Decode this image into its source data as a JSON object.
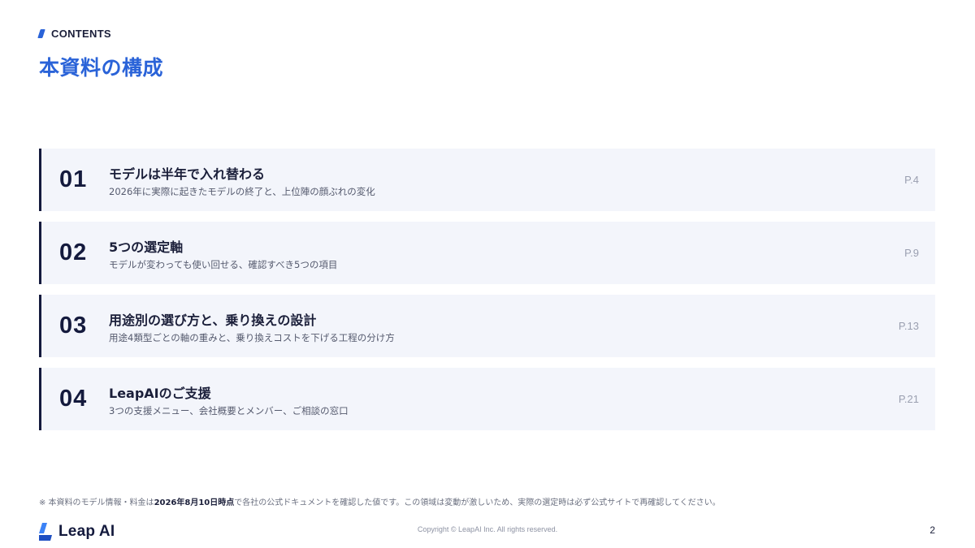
{
  "header": {
    "eyebrow": "CONTENTS",
    "title": "本資料の構成"
  },
  "toc": [
    {
      "num": "01",
      "title": "モデルは半年で入れ替わる",
      "desc": "2026年に実際に起きたモデルの終了と、上位陣の顔ぶれの変化",
      "page": "P.4"
    },
    {
      "num": "02",
      "title": "5つの選定軸",
      "desc": "モデルが変わっても使い回せる、確認すべき5つの項目",
      "page": "P.9"
    },
    {
      "num": "03",
      "title": "用途別の選び方と、乗り換えの設計",
      "desc": "用途4類型ごとの軸の重みと、乗り換えコストを下げる工程の分け方",
      "page": "P.13"
    },
    {
      "num": "04",
      "title": "LeapAIのご支援",
      "desc": "3つの支援メニュー、会社概要とメンバー、ご相談の窓口",
      "page": "P.21"
    }
  ],
  "footer": {
    "note_prefix": "※ 本資料のモデル情報・料金は",
    "note_bold": "2026年8月10日時点",
    "note_suffix": "で各社の公式ドキュメントを確認した値です。この領域は変動が激しいため、実際の選定時は必ず公式サイトで再確認してください。",
    "logo_text": "Leap AI",
    "copyright": "Copyright © LeapAI Inc. All rights reserved.",
    "page_number": "2"
  },
  "colors": {
    "accent": "#2a63d8",
    "navy": "#141a3d",
    "card_bg": "#f3f5fb"
  },
  "icons": {
    "eyebrow": "slanted-bar-icon",
    "logo": "leap-ai-logo-icon"
  }
}
